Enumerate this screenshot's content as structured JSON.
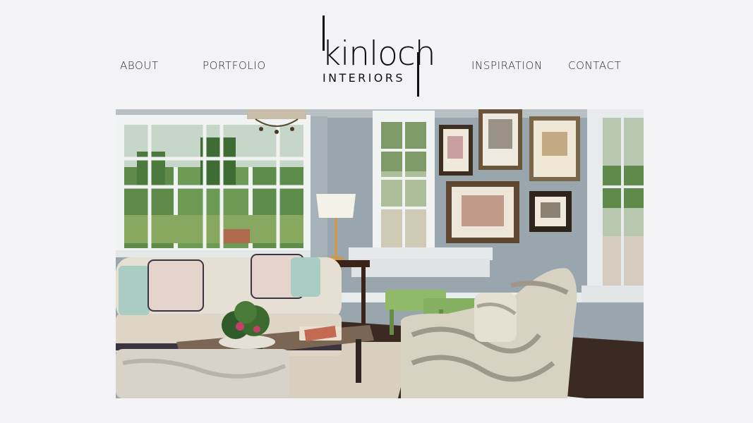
{
  "nav": {
    "about": "ABOUT",
    "portfolio": "PORTFOLIO",
    "inspiration": "INSPIRATION",
    "contact": "CONTACT"
  },
  "logo": {
    "word": "kinloch",
    "sub": "INTERIORS"
  },
  "colors": {
    "background": "#f3f3f5",
    "text": "#2a2a2a",
    "wall": "#9aa6ad"
  }
}
